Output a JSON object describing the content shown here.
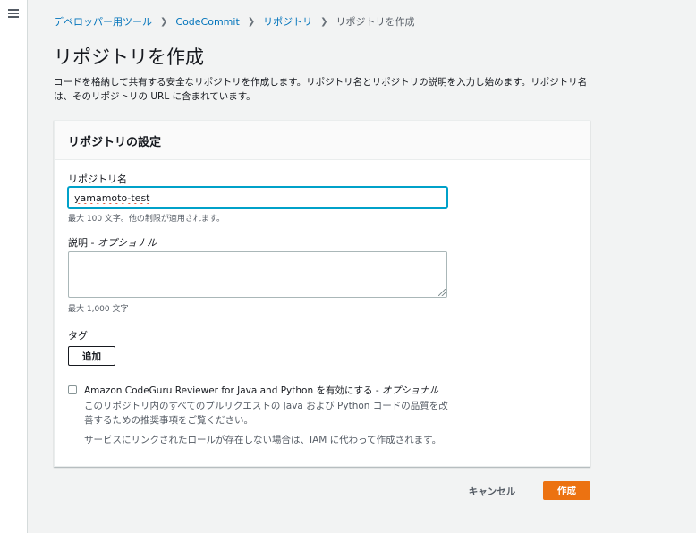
{
  "breadcrumb": {
    "items": [
      "デベロッパー用ツール",
      "CodeCommit",
      "リポジトリ"
    ],
    "current": "リポジトリを作成"
  },
  "page": {
    "title": "リポジトリを作成",
    "description": "コードを格納して共有する安全なリポジトリを作成します。リポジトリ名とリポジトリの説明を入力し始めます。リポジトリ名は、そのリポジトリの URL に含まれています。"
  },
  "panel": {
    "header": "リポジトリの設定",
    "repo_name_label": "リポジトリ名",
    "repo_name_value": "yamamoto-test",
    "repo_name_hint": "最大 100 文字。他の制限が適用されます。",
    "description_label": "説明 - ",
    "description_optional": "オプショナル",
    "description_hint": "最大 1,000 文字",
    "tags_label": "タグ",
    "add_button": "追加",
    "codeguru_label": "Amazon CodeGuru Reviewer for Java and Python を有効にする - ",
    "codeguru_optional": "オプショナル",
    "codeguru_desc": "このリポジトリ内のすべてのプルリクエストの Java および Python コードの品質を改善するための推奨事項をご覧ください。",
    "codeguru_note": "サービスにリンクされたロールが存在しない場合は、IAM に代わって作成されます。"
  },
  "footer": {
    "cancel": "キャンセル",
    "create": "作成"
  },
  "colors": {
    "primary": "#ec7211",
    "link": "#0073bb",
    "focus": "#00a1c9"
  },
  "icons": {
    "menu": "hamburger-menu-icon",
    "separator": "chevron-right-icon"
  }
}
